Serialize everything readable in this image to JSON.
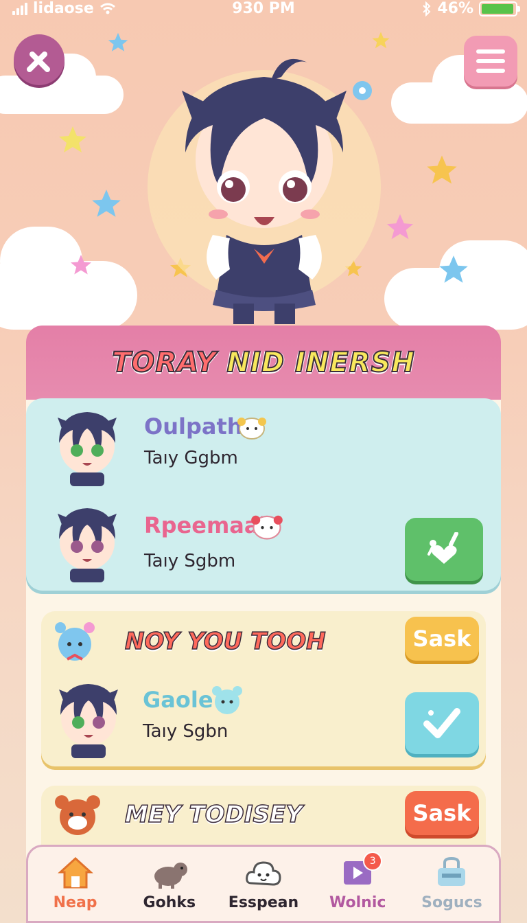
{
  "status_bar": {
    "carrier": "lidaose",
    "time": "930 PM",
    "battery": "46%",
    "battery_level": 0.95
  },
  "header": {
    "back_icon": "back-icon",
    "menu_icon": "menu-icon"
  },
  "panel": {
    "title_part1": "TORAY",
    "title_part2": "NID INERSH",
    "friends": [
      {
        "name": "Oulpath",
        "sub": "Taıy Ggbm",
        "name_color": "#7c73c7"
      },
      {
        "name": "Rpeemaal",
        "sub": "Taıy Sgbm",
        "name_color": "#e9658f"
      }
    ],
    "friends_action_icon": "heart-check-icon",
    "section1": {
      "title": "NOY YOU TOOH",
      "button_label": "Sask",
      "friend": {
        "name": "Gaole",
        "sub": "Taıy Sgbn",
        "name_color": "#6ac3d6"
      },
      "check_icon": "checkmark-icon"
    },
    "section2": {
      "title": "MEY TODISEY",
      "button_label": "Sask"
    }
  },
  "tabs": [
    {
      "label": "Neap",
      "icon": "home-icon",
      "color": "#f0714a"
    },
    {
      "label": "Gohks",
      "icon": "pet-icon",
      "color": "#2e2630"
    },
    {
      "label": "Esspean",
      "icon": "cloud-face-icon",
      "color": "#2e2630"
    },
    {
      "label": "Wolnic",
      "icon": "video-icon",
      "color": "#b259a0",
      "badge": "3"
    },
    {
      "label": "Sogucs",
      "icon": "bag-icon",
      "color": "#9fb0bf"
    }
  ]
}
